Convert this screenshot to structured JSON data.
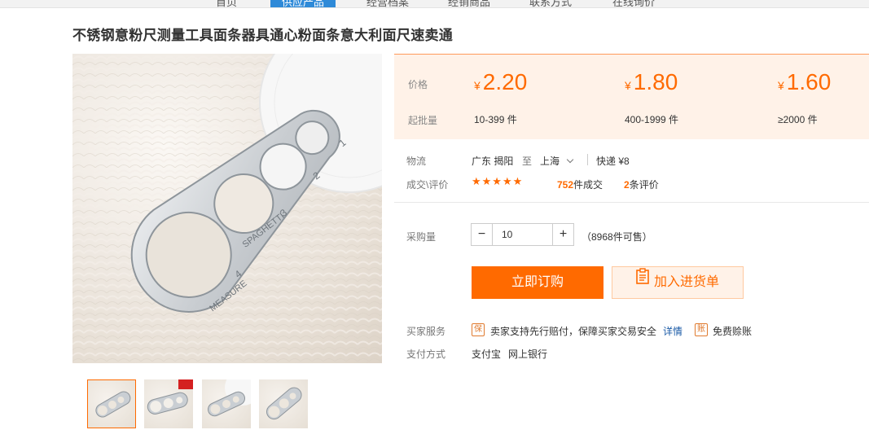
{
  "topnav": {
    "items": [
      "首页",
      "供应产品",
      "经营档案",
      "经销商品",
      "联系方式",
      "在线询价"
    ],
    "active_index": 1
  },
  "title": "不锈钢意粉尺测量工具面条器具通心粉面条意大利面尺速卖通",
  "image": {
    "text_labels": [
      "SPAGHETTI",
      "MEASURE"
    ],
    "numbers": [
      "1",
      "2",
      "3",
      "4"
    ]
  },
  "thumbnails_count": 4,
  "price_box": {
    "price_label": "价格",
    "batch_label": "起批量",
    "currency": "¥",
    "tiers": [
      {
        "price": "2.20",
        "qty": "10-399 件"
      },
      {
        "price": "1.80",
        "qty": "400-1999 件"
      },
      {
        "price": "1.60",
        "qty": "≥2000 件"
      }
    ]
  },
  "logistics": {
    "label": "物流",
    "from": "广东 揭阳",
    "to_word": "至",
    "to": "上海",
    "express": "快递 ¥8"
  },
  "deals": {
    "label": "成交\\评价",
    "stars": "★★★★★",
    "sold_num": "752",
    "sold_text": "件成交",
    "review_num": "2",
    "review_text": "条评价"
  },
  "purchase": {
    "label": "采购量",
    "minus": "−",
    "plus": "+",
    "value": "10",
    "available": "（8968件可售）"
  },
  "buttons": {
    "buy": "立即订购",
    "cart": "加入进货单"
  },
  "services": {
    "label": "买家服务",
    "icon1": "保",
    "text1": "卖家支持先行赔付，保障买家交易安全",
    "details_link": "详情",
    "icon2": "账",
    "text2": "免费赊账"
  },
  "payment": {
    "label": "支付方式",
    "methods": [
      "支付宝",
      "网上银行"
    ]
  },
  "colors": {
    "accent": "#ff6a00",
    "price_bg": "#fff2e8",
    "link": "#1a5aa6",
    "nav_active": "#2e8ad8"
  }
}
